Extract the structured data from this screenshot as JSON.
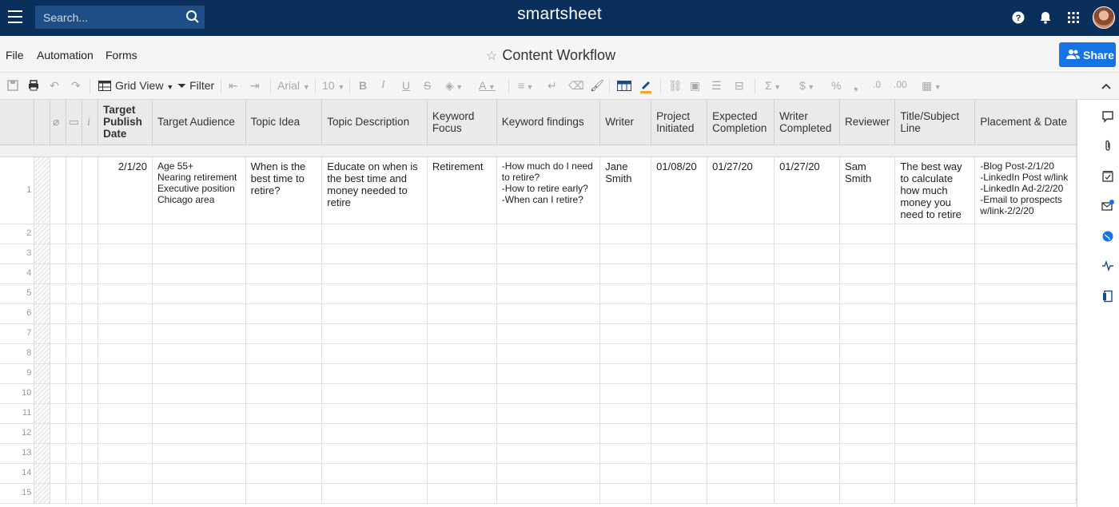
{
  "topbar": {
    "search_placeholder": "Search...",
    "logo": "smartsheet"
  },
  "menubar": {
    "items": [
      "File",
      "Automation",
      "Forms"
    ],
    "sheet_title": "Content Workflow",
    "share_label": "Share"
  },
  "toolbar": {
    "view_label": "Grid View",
    "filter_label": "Filter",
    "font": "Arial",
    "font_size": "10"
  },
  "columns": [
    "Target Publish Date",
    "Target Audience",
    "Topic Idea",
    "Topic Description",
    "Keyword Focus",
    "Keyword findings",
    "Writer",
    "Project Initiated",
    "Expected Completion",
    "Writer Completed",
    "Reviewer",
    "Title/Subject Line",
    "Placement & Date"
  ],
  "rows": [
    {
      "num": "1",
      "target_publish_date": "2/1/20",
      "target_audience": "Age 55+\nNearing retirement\nExecutive position\nChicago area",
      "topic_idea": "When is the best time to retire?",
      "topic_description": "Educate on when is the best time and money needed to retire",
      "keyword_focus": "Retirement",
      "keyword_findings": "-How much do I need to retire?\n-How to retire early?\n-When can I retire?",
      "writer": "Jane Smith",
      "project_initiated": "01/08/20",
      "expected_completion": "01/27/20",
      "writer_completed": "01/27/20",
      "reviewer": "Sam Smith",
      "title_subject_line": "The best way to calculate how much money you need to retire",
      "placement_date": "-Blog Post-2/1/20\n-LinkedIn Post w/link\n-LinkedIn Ad-2/2/20\n-Email to prospects w/link-2/2/20"
    }
  ],
  "empty_rows": [
    "2",
    "3",
    "4",
    "5",
    "6",
    "7",
    "8",
    "9",
    "10",
    "11",
    "12",
    "13",
    "14",
    "15"
  ],
  "colors": {
    "topbar": "#0b2f5b",
    "search_bg": "#1f4e86",
    "share": "#1573e6"
  }
}
